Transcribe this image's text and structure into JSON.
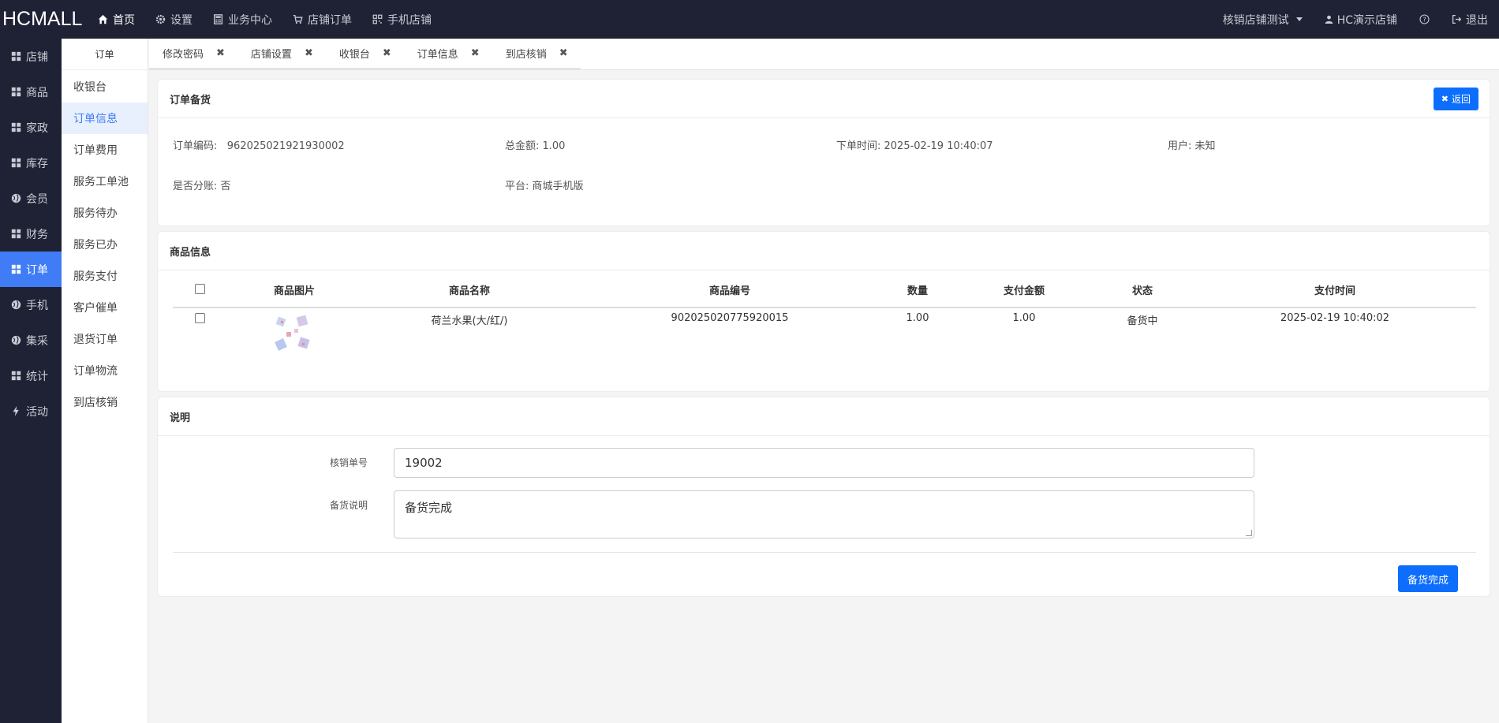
{
  "brand": "HCMALL",
  "topnav": [
    {
      "label": "首页",
      "icon": "home-icon"
    },
    {
      "label": "设置",
      "icon": "gear-icon"
    },
    {
      "label": "业务中心",
      "icon": "calculator-icon"
    },
    {
      "label": "店铺订单",
      "icon": "cart-icon"
    },
    {
      "label": "手机店铺",
      "icon": "qrcode-icon"
    }
  ],
  "topright": {
    "store": "核销店铺测试",
    "user": "HC演示店铺",
    "logout": "退出"
  },
  "side1": [
    {
      "label": "店铺",
      "icon": "grid-icon"
    },
    {
      "label": "商品",
      "icon": "grid-icon"
    },
    {
      "label": "家政",
      "icon": "grid-icon"
    },
    {
      "label": "库存",
      "icon": "grid-icon"
    },
    {
      "label": "会员",
      "icon": "globe-icon"
    },
    {
      "label": "财务",
      "icon": "grid-icon"
    },
    {
      "label": "订单",
      "icon": "grid-icon"
    },
    {
      "label": "手机",
      "icon": "globe-icon"
    },
    {
      "label": "集采",
      "icon": "globe-icon"
    },
    {
      "label": "统计",
      "icon": "grid-icon"
    },
    {
      "label": "活动",
      "icon": "bolt-icon"
    }
  ],
  "side2": {
    "header": "订单",
    "items": [
      "收银台",
      "订单信息",
      "订单费用",
      "服务工单池",
      "服务待办",
      "服务已办",
      "服务支付",
      "客户催单",
      "退货订单",
      "订单物流",
      "到店核销"
    ]
  },
  "tabs": [
    "修改密码",
    "店铺设置",
    "收银台",
    "订单信息",
    "到店核销"
  ],
  "order_card": {
    "title": "订单备货",
    "back_label": "返回",
    "order_no": "订单编码:   962025021921930002",
    "total": "总金额: 1.00",
    "time": "下单时间: 2025-02-19 10:40:07",
    "user": "用户: 未知",
    "split": "是否分账: 否",
    "platform": "平台: 商城手机版"
  },
  "goods_card": {
    "title": "商品信息",
    "headers": [
      "商品图片",
      "商品名称",
      "商品编号",
      "数量",
      "支付金额",
      "状态",
      "支付时间"
    ],
    "row": {
      "name": "荷兰水果(大/红/)",
      "code": "902025020775920015",
      "qty": "1.00",
      "amount": "1.00",
      "status": "备货中",
      "pay_time": "2025-02-19 10:40:02"
    }
  },
  "note_card": {
    "title": "说明",
    "verify_label": "核销单号",
    "verify_value": "19002",
    "note_label": "备货说明",
    "note_value": "备货完成",
    "submit_label": "备货完成"
  }
}
